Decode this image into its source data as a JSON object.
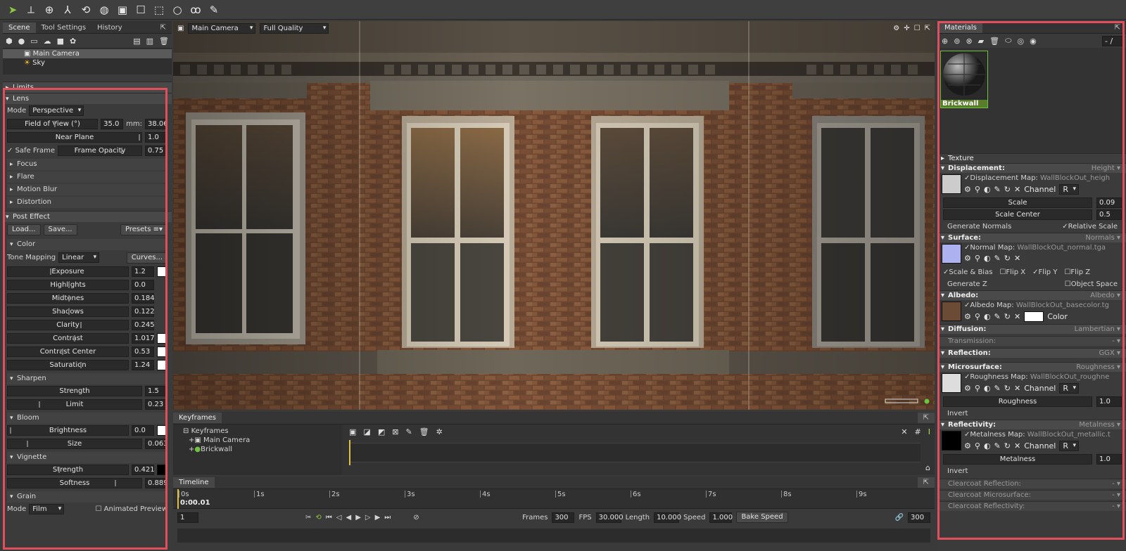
{
  "toolbar": {
    "tools": [
      "select-arrow",
      "transform-axes",
      "sphere-grid",
      "axes-gizmo",
      "rotate-gizmo",
      "sphere-wire",
      "camera-frame",
      "square-outline",
      "dashed-rect",
      "circle-outline",
      "lasso",
      "paint-brush"
    ]
  },
  "left": {
    "tabs": [
      "Scene",
      "Tool Settings",
      "History"
    ],
    "tree": [
      "Main Camera",
      "Sky"
    ],
    "limits": "Limits",
    "lens": {
      "title": "Lens",
      "mode_label": "Mode",
      "mode_value": "Perspective",
      "fov_label": "Field of View (°)",
      "fov_value": "35.0",
      "mm_label": "mm:",
      "mm_value": "38.06",
      "near_label": "Near Plane",
      "near_value": "1.0",
      "safe_frame": "Safe Frame",
      "opacity_label": "Frame Opacity",
      "opacity_value": "0.75",
      "subs": [
        "Focus",
        "Flare",
        "Motion Blur",
        "Distortion"
      ]
    },
    "post": {
      "title": "Post Effect",
      "load": "Load...",
      "save": "Save...",
      "presets": "Presets",
      "color": "Color",
      "tone_label": "Tone Mapping",
      "tone_value": "Linear",
      "curves": "Curves...",
      "rows": [
        {
          "label": "Exposure",
          "value": "1.2"
        },
        {
          "label": "Highlights",
          "value": "0.0"
        },
        {
          "label": "Midtones",
          "value": "0.184"
        },
        {
          "label": "Shadows",
          "value": "0.122"
        },
        {
          "label": "Clarity",
          "value": "0.245"
        },
        {
          "label": "Contrast",
          "value": "1.017"
        },
        {
          "label": "Contrast Center",
          "value": "0.53"
        },
        {
          "label": "Saturation",
          "value": "1.24"
        }
      ],
      "sharpen": "Sharpen",
      "strength_label": "Strength",
      "strength_value": "1.5",
      "limit_label": "Limit",
      "limit_value": "0.23",
      "bloom": "Bloom",
      "brightness_label": "Brightness",
      "brightness_value": "0.0",
      "size_label": "Size",
      "size_value": "0.063",
      "vignette": "Vignette",
      "vstrength_label": "Strength",
      "vstrength_value": "0.421",
      "softness_label": "Softness",
      "softness_value": "0.889",
      "grain": "Grain",
      "grain_mode_label": "Mode",
      "grain_mode_value": "Film",
      "animated": "Animated Preview"
    }
  },
  "view": {
    "camera": "Main Camera",
    "quality": "Full Quality"
  },
  "keyframes": {
    "title": "Keyframes",
    "tree": [
      "Keyframes",
      "Main Camera",
      "Brickwall"
    ]
  },
  "timeline": {
    "title": "Timeline",
    "current": "0:00.01",
    "ticks": [
      "0s",
      "1s",
      "2s",
      "3s",
      "4s",
      "5s",
      "6s",
      "7s",
      "8s",
      "9s"
    ],
    "frame_field": "1",
    "frames_label": "Frames",
    "frames_value": "300",
    "fps_label": "FPS",
    "fps_value": "30.000",
    "length_label": "Length",
    "length_value": "10.000",
    "speed_label": "Speed",
    "speed_value": "1.000",
    "bake": "Bake Speed",
    "end_value": "300"
  },
  "right": {
    "tab": "Materials",
    "counter": "- /",
    "material": "Brickwall",
    "texture": "Texture",
    "disp": {
      "title": "Displacement:",
      "mode": "Height",
      "map_label": "Displacement Map:",
      "map_file": "WallBlockOut_heigh",
      "channel_label": "Channel",
      "channel": "R",
      "scale_label": "Scale",
      "scale": "0.09",
      "center_label": "Scale Center",
      "center": "0.5",
      "gen_normals": "Generate Normals",
      "relative": "Relative Scale"
    },
    "surface": {
      "title": "Surface:",
      "mode": "Normals",
      "map_label": "Normal Map:",
      "map_file": "WallBlockOut_normal.tga",
      "scale_bias": "Scale & Bias",
      "flipx": "Flip X",
      "flipy": "Flip Y",
      "flipz": "Flip Z",
      "genz": "Generate Z",
      "object": "Object Space"
    },
    "albedo": {
      "title": "Albedo:",
      "mode": "Albedo",
      "map_label": "Albedo Map:",
      "map_file": "WallBlockOut_basecolor.tg",
      "color_label": "Color"
    },
    "diffusion": {
      "title": "Diffusion:",
      "mode": "Lambertian",
      "transmission": "Transmission:",
      "trans_value": "-"
    },
    "reflection": {
      "title": "Reflection:",
      "mode": "GGX"
    },
    "micro": {
      "title": "Microsurface:",
      "mode": "Roughness",
      "map_label": "Roughness Map:",
      "map_file": "WallBlockOut_roughne",
      "channel_label": "Channel",
      "channel": "R",
      "rough_label": "Roughness",
      "rough_value": "1.0",
      "invert": "Invert"
    },
    "reflectivity": {
      "title": "Reflectivity:",
      "mode": "Metalness",
      "map_label": "Metalness Map:",
      "map_file": "WallBlockOut_metallic.t",
      "channel_label": "Channel",
      "channel": "R",
      "metal_label": "Metalness",
      "metal_value": "1.0",
      "invert": "Invert"
    },
    "clearcoat": [
      "Clearcoat Reflection:",
      "Clearcoat Microsurface:",
      "Clearcoat Reflectivity:"
    ],
    "clearcoat_value": "-"
  }
}
